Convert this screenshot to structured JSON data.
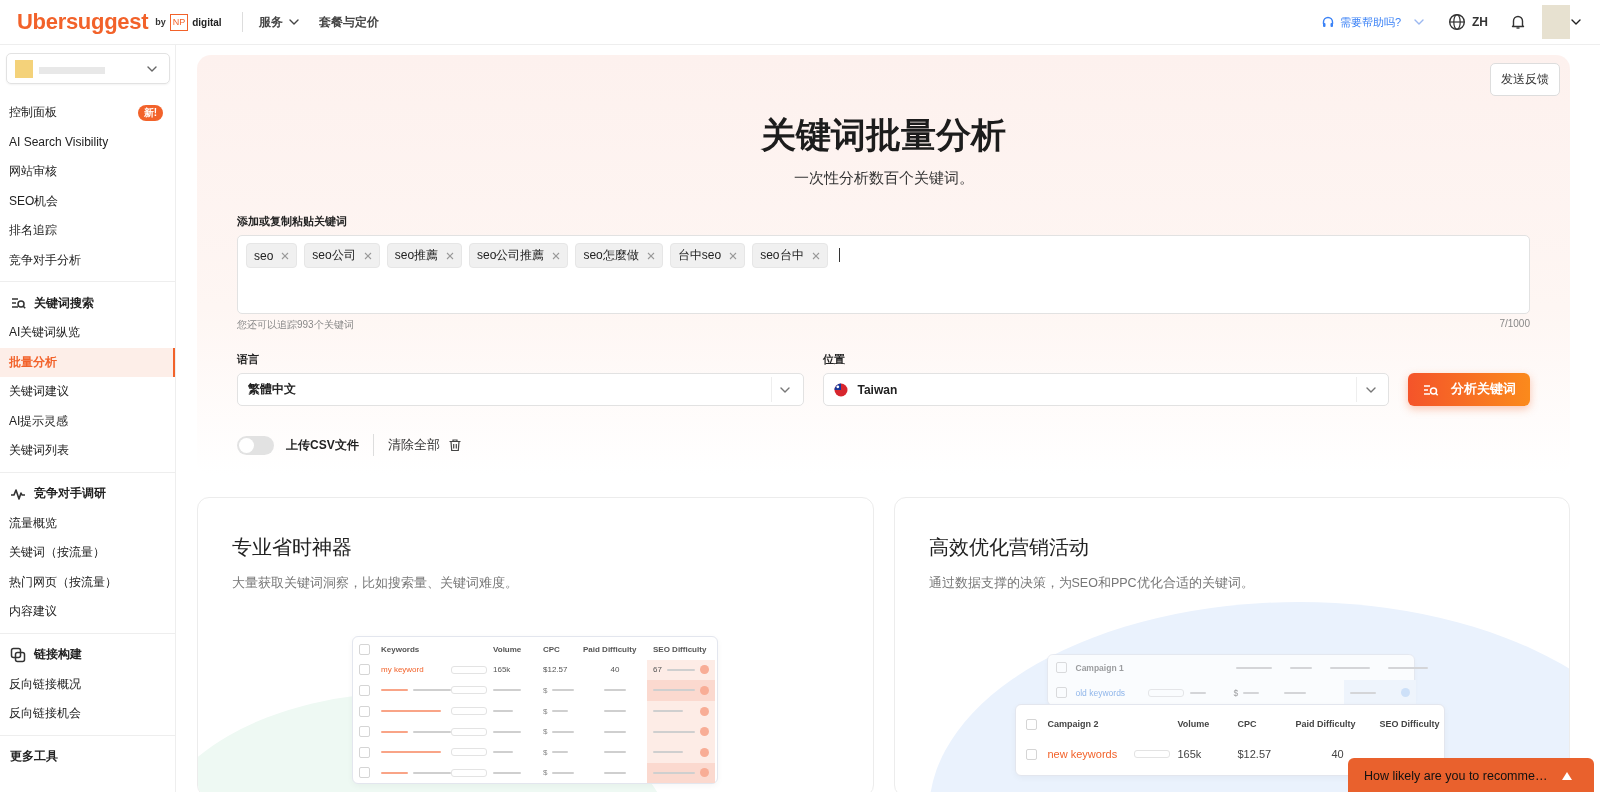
{
  "header": {
    "logo": "Ubersuggest",
    "by": "by",
    "np": "NP",
    "digital": "digital",
    "nav": [
      {
        "label": "服务",
        "dropdown": true
      },
      {
        "label": "套餐与定价",
        "dropdown": false
      }
    ],
    "help": "需要帮助吗?",
    "language": "ZH"
  },
  "sidebar": {
    "groups": [
      {
        "items": [
          {
            "label": "控制面板",
            "badge": "新!",
            "selected": false
          },
          {
            "label": "AI Search Visibility",
            "selected": false
          },
          {
            "label": "网站审核",
            "selected": false
          },
          {
            "label": "SEO机会",
            "selected": false
          },
          {
            "label": "排名追踪",
            "selected": false
          },
          {
            "label": "竞争对手分析",
            "selected": false
          }
        ]
      },
      {
        "heading": "关键词搜索",
        "items": [
          {
            "label": "AI关键词纵览",
            "selected": false
          },
          {
            "label": "批量分析",
            "selected": true
          },
          {
            "label": "关键词建议",
            "selected": false
          },
          {
            "label": "AI提示灵感",
            "selected": false
          },
          {
            "label": "关键词列表",
            "selected": false
          }
        ]
      },
      {
        "heading": "竞争对手调研",
        "items": [
          {
            "label": "流量概览",
            "selected": false
          },
          {
            "label": "关键词（按流量）",
            "selected": false
          },
          {
            "label": "热门网页（按流量）",
            "selected": false
          },
          {
            "label": "内容建议",
            "selected": false
          }
        ]
      },
      {
        "heading": "链接构建",
        "items": [
          {
            "label": "反向链接概况",
            "selected": false
          },
          {
            "label": "反向链接机会",
            "selected": false
          }
        ]
      },
      {
        "heading": "更多工具"
      }
    ]
  },
  "feedback_button": "发送反馈",
  "hero": {
    "title": "关键词批量分析",
    "subtitle": "一次性分析数百个关键词。"
  },
  "keywords": {
    "label": "添加或复制粘贴关键词",
    "tags": [
      "seo",
      "seo公司",
      "seo推薦",
      "seo公司推薦",
      "seo怎麼做",
      "台中seo",
      "seo台中"
    ],
    "hint": "您还可以追踪993个关键词",
    "count": "7/1000"
  },
  "language": {
    "label": "语言",
    "value": "繁體中文"
  },
  "location": {
    "label": "位置",
    "value": "Taiwan"
  },
  "analyze_button": "分析关键词",
  "csv_toggle": {
    "label": "上传CSV文件",
    "on": false
  },
  "clear_all": "清除全部",
  "cards": [
    {
      "title": "专业省时神器",
      "description": "大量获取关键词洞察，比如搜索量、关键词难度。",
      "illustration": {
        "kind": "keyword-table",
        "header_checked": false,
        "columns": [
          "Keywords",
          "Volume",
          "CPC",
          "Paid Difficulty",
          "SEO Difficulty"
        ],
        "rows": [
          {
            "kind": "data",
            "checked": false,
            "keyword": "my keyword",
            "volume": "165k",
            "cpc": "$12.57",
            "paid": "40",
            "seo": "67"
          },
          {
            "kind": "placeholder",
            "checked": false,
            "cpc": "$"
          },
          {
            "kind": "placeholder",
            "checked": false,
            "cpc": "$"
          },
          {
            "kind": "placeholder",
            "checked": false,
            "cpc": "$"
          },
          {
            "kind": "placeholder",
            "checked": false,
            "cpc": "$"
          },
          {
            "kind": "placeholder",
            "checked": false,
            "cpc": "$"
          }
        ]
      }
    },
    {
      "title": "高效优化营销活动",
      "description": "通过数据支撑的决策，为SEO和PPC优化合适的关键词。",
      "illustration": {
        "kind": "campaign-stack",
        "back": {
          "heading": "Campaign 1",
          "heading_checked": false,
          "keyword": "old keywords",
          "keyword_checked": false,
          "cpc": "$"
        },
        "front": {
          "columns": [
            "Campaign 2",
            "Volume",
            "CPC",
            "Paid Difficulty",
            "SEO Difficulty"
          ],
          "heading_checked": false,
          "keyword": "new keywords",
          "keyword_checked": false,
          "volume": "165k",
          "cpc": "$12.57",
          "paid": "40"
        }
      }
    }
  ],
  "survey": {
    "text": "How likely are you to recomme…"
  }
}
